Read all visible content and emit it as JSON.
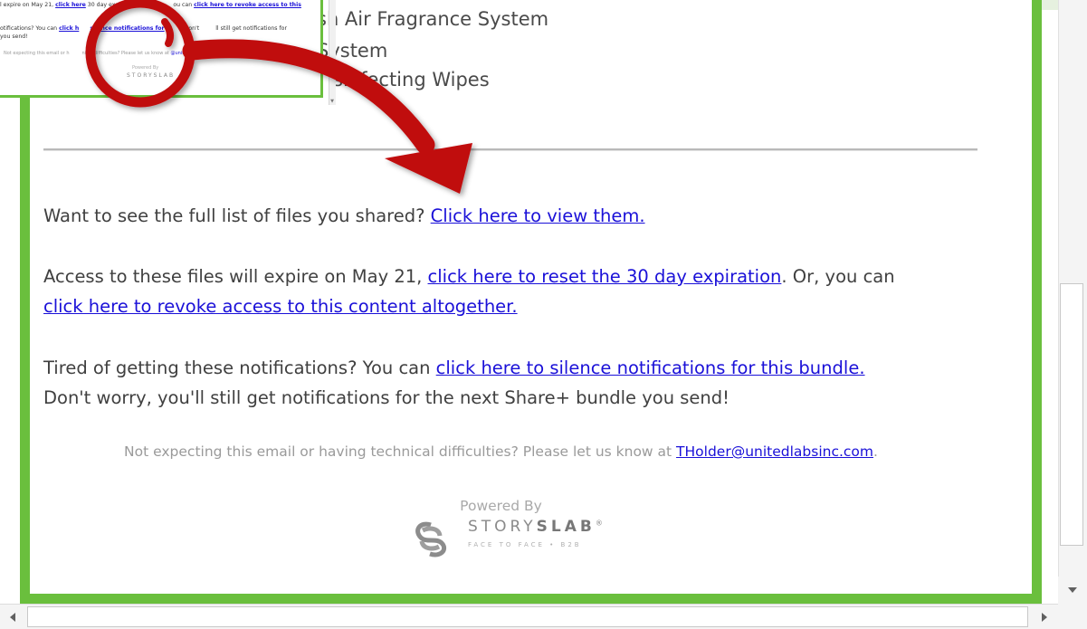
{
  "product_lines": [
    "sh Air Fragrance System",
    "System",
    "sinfecting Wipes"
  ],
  "full_list": {
    "text": "Want to see the full list of files you shared? ",
    "link": "Click here to view them."
  },
  "access": {
    "text_before": "Access to these files will expire on May 21, ",
    "reset_link": "click here to reset the 30 day expiration",
    "text_middle": ". Or, you can",
    "revoke_link": "click here to revoke access to this content altogether."
  },
  "notifications": {
    "text_before": "Tired of getting these notifications? You can ",
    "silence_link": "click here to silence notifications for this bundle.",
    "line2": "Don't worry, you'll still get notifications for the next Share+ bundle you send!"
  },
  "footer": {
    "note": "Not expecting this email or having technical difficulties? Please let us know at ",
    "email": "THolder@unitedlabsinc.com",
    "period": ".",
    "powered_by": "Powered By"
  },
  "logo": {
    "word_light": "STORY",
    "word_bold": "SLAB",
    "reg": "®",
    "tagline": "FACE TO FACE • B2B"
  },
  "preview": {
    "line1_a": "l expire on May 21, ",
    "line1_link_a": "click here",
    "line1_b": "  30 day expira",
    "line1_c": "ou can ",
    "line1_link_b": "click here to revoke access to this",
    "line2_a": "otifications? You can ",
    "line2_link_a": "click h",
    "line2_link_b": "silence notifications for",
    "line2_b": " Don't",
    "line2_c": "ll still get notifications for",
    "line3": "you send!",
    "note": "Not expecting this email or h",
    "note_b": "nical difficulties? Please let us know at ",
    "note_link": "@unitedlabsinc.com",
    "pb": "Powered By",
    "logo": "STORYSLAB"
  },
  "colors": {
    "frame_green": "#6abf3d",
    "link_blue": "#1a10d8",
    "annotation_red": "#c0080c"
  }
}
